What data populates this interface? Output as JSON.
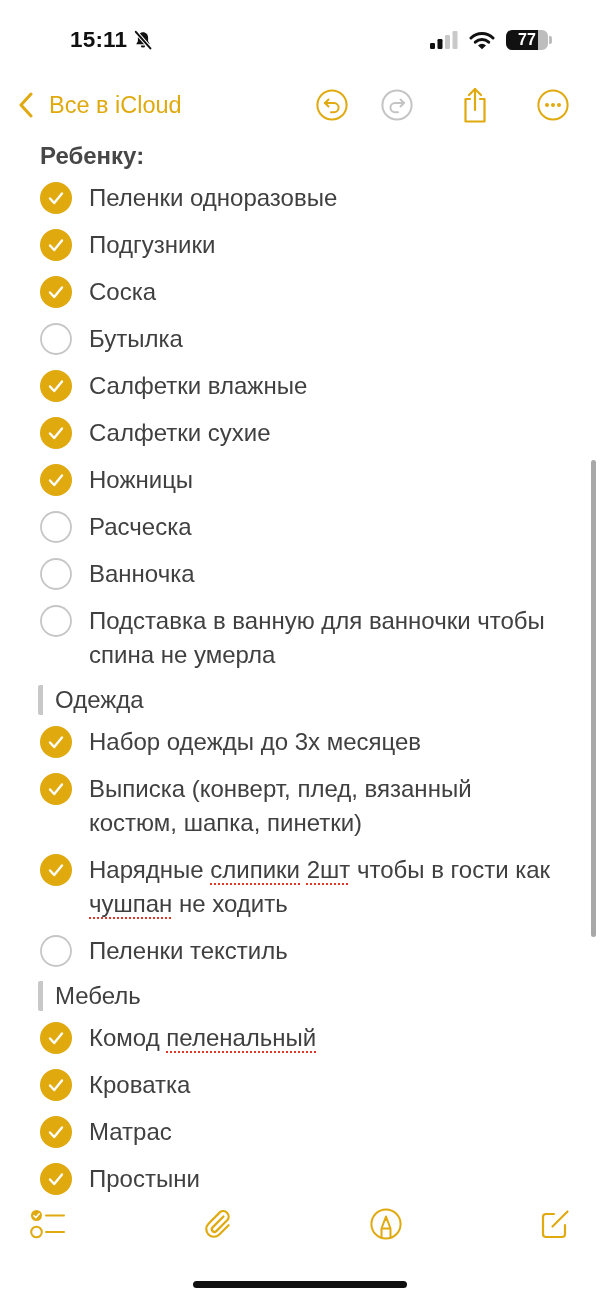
{
  "status_bar": {
    "time": "15:11",
    "silent": true,
    "battery": "77"
  },
  "nav": {
    "back_label": "Все в iCloud",
    "undo": {
      "disabled": false
    },
    "redo": {
      "disabled": true
    }
  },
  "note": {
    "sections": [
      {
        "kind": "heading",
        "title": "Ребенку:",
        "items": [
          {
            "checked": true,
            "text": "Пеленки одноразовые"
          },
          {
            "checked": true,
            "text": "Подгузники"
          },
          {
            "checked": true,
            "text": "Соска"
          },
          {
            "checked": false,
            "text": "Бутылка"
          },
          {
            "checked": true,
            "text": "Салфетки влажные"
          },
          {
            "checked": true,
            "text": "Салфетки сухие"
          },
          {
            "checked": true,
            "text": "Ножницы"
          },
          {
            "checked": false,
            "text": "Расческа"
          },
          {
            "checked": false,
            "text": "Ванночка"
          },
          {
            "checked": false,
            "text": "Подставка в ванную для ванночки чтобы спина не умерла"
          }
        ]
      },
      {
        "kind": "quote",
        "title": "Одежда",
        "items": [
          {
            "checked": true,
            "text": "Набор одежды до 3х месяцев"
          },
          {
            "checked": true,
            "text": "Выписка (конверт, плед, вязанный костюм, шапка, пинетки)"
          },
          {
            "checked": true,
            "parts": [
              {
                "text": "Нарядные ",
                "misspelled": false
              },
              {
                "text": "слипики 2шт",
                "misspelled": true
              },
              {
                "text": " чтобы в гости как ",
                "misspelled": false
              },
              {
                "text": "чушпан",
                "misspelled": true
              },
              {
                "text": " не ходить",
                "misspelled": false
              }
            ]
          },
          {
            "checked": false,
            "text": "Пеленки текстиль"
          }
        ]
      },
      {
        "kind": "quote",
        "title": "Мебель",
        "items": [
          {
            "checked": true,
            "parts": [
              {
                "text": "Комод ",
                "misspelled": false
              },
              {
                "text": "пеленальный",
                "misspelled": true
              }
            ]
          },
          {
            "checked": true,
            "text": "Кроватка"
          },
          {
            "checked": true,
            "text": "Матрас"
          },
          {
            "checked": true,
            "text": "Простыни"
          }
        ]
      }
    ]
  }
}
